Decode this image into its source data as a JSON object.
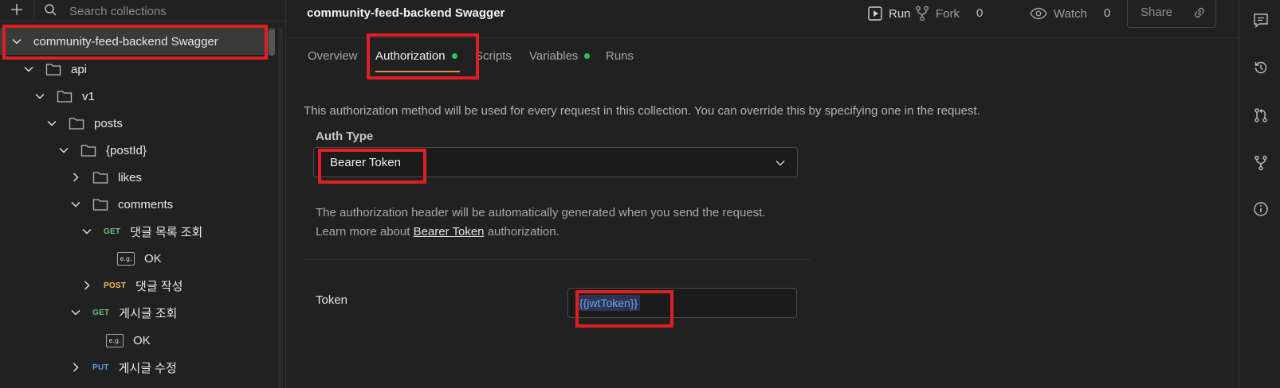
{
  "sidebar": {
    "search_placeholder": "Search collections",
    "tree": [
      {
        "label": "community-feed-backend Swagger",
        "type": "collection",
        "expanded": true
      },
      {
        "label": "api",
        "type": "folder",
        "expanded": true
      },
      {
        "label": "v1",
        "type": "folder",
        "expanded": true
      },
      {
        "label": "posts",
        "type": "folder",
        "expanded": true
      },
      {
        "label": "{postId}",
        "type": "folder",
        "expanded": true
      },
      {
        "label": "likes",
        "type": "folder",
        "expanded": false
      },
      {
        "label": "comments",
        "type": "folder",
        "expanded": true
      },
      {
        "label": "댓글 목록 조회",
        "type": "request",
        "method": "GET",
        "expanded": true
      },
      {
        "label": "OK",
        "type": "example",
        "badge": "e.g."
      },
      {
        "label": "댓글 작성",
        "type": "request",
        "method": "POST",
        "expanded": false
      },
      {
        "label": "게시글 조회",
        "type": "request",
        "method": "GET",
        "expanded": true
      },
      {
        "label": "OK",
        "type": "example",
        "badge": "e.g."
      },
      {
        "label": "게시글 수정",
        "type": "request",
        "method": "PUT",
        "expanded": false
      }
    ]
  },
  "header": {
    "title": "community-feed-backend Swagger",
    "run_label": "Run",
    "fork_label": "Fork",
    "fork_count": "0",
    "watch_label": "Watch",
    "watch_count": "0",
    "share_label": "Share"
  },
  "tabs": [
    {
      "label": "Overview",
      "dot": false,
      "active": false
    },
    {
      "label": "Authorization",
      "dot": true,
      "active": true
    },
    {
      "label": "Scripts",
      "dot": false,
      "active": false
    },
    {
      "label": "Variables",
      "dot": true,
      "active": false
    },
    {
      "label": "Runs",
      "dot": false,
      "active": false
    }
  ],
  "auth": {
    "description": "This authorization method will be used for every request in this collection. You can override this by specifying one in the request.",
    "type_label": "Auth Type",
    "type_value": "Bearer Token",
    "info_line1": "The authorization header will be automatically generated when you send the request.",
    "info_line2_prefix": "Learn more about ",
    "info_line2_link": "Bearer Token",
    "info_line2_suffix": " authorization.",
    "token_label": "Token",
    "token_value": "{{jwtToken}}"
  },
  "colors": {
    "accent_tab": "#e58a4b",
    "dot_green": "#2fbf5c",
    "get": "#6bbf7d",
    "post": "#e8c14b",
    "put": "#5c9be6",
    "highlight": "#e01e26"
  },
  "rail_icons": [
    "comment-icon",
    "history-icon",
    "pull-request-icon",
    "fork-icon",
    "info-icon"
  ]
}
